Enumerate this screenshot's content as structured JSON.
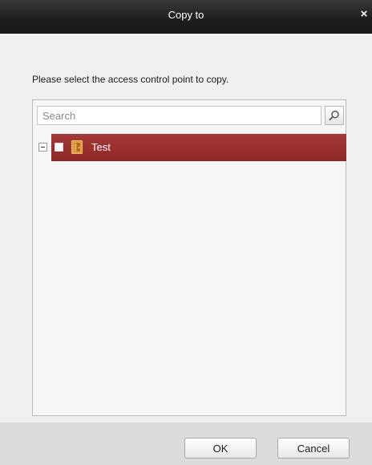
{
  "dialog": {
    "title": "Copy to",
    "close_glyph": "×",
    "instruction": "Please select the access control point to copy."
  },
  "search": {
    "placeholder": "Search",
    "value": "",
    "button_icon": "search-icon"
  },
  "tree": {
    "items": [
      {
        "label": "Test",
        "icon": "door-icon",
        "expanded": true,
        "checked": false,
        "selected": true
      }
    ]
  },
  "footer": {
    "ok_label": "OK",
    "cancel_label": "Cancel"
  },
  "colors": {
    "title_bar": "#1f1f1f",
    "selected_row": "#982e2d",
    "footer_bg": "#dcdcdc",
    "dialog_bg": "#f0f0f0"
  }
}
